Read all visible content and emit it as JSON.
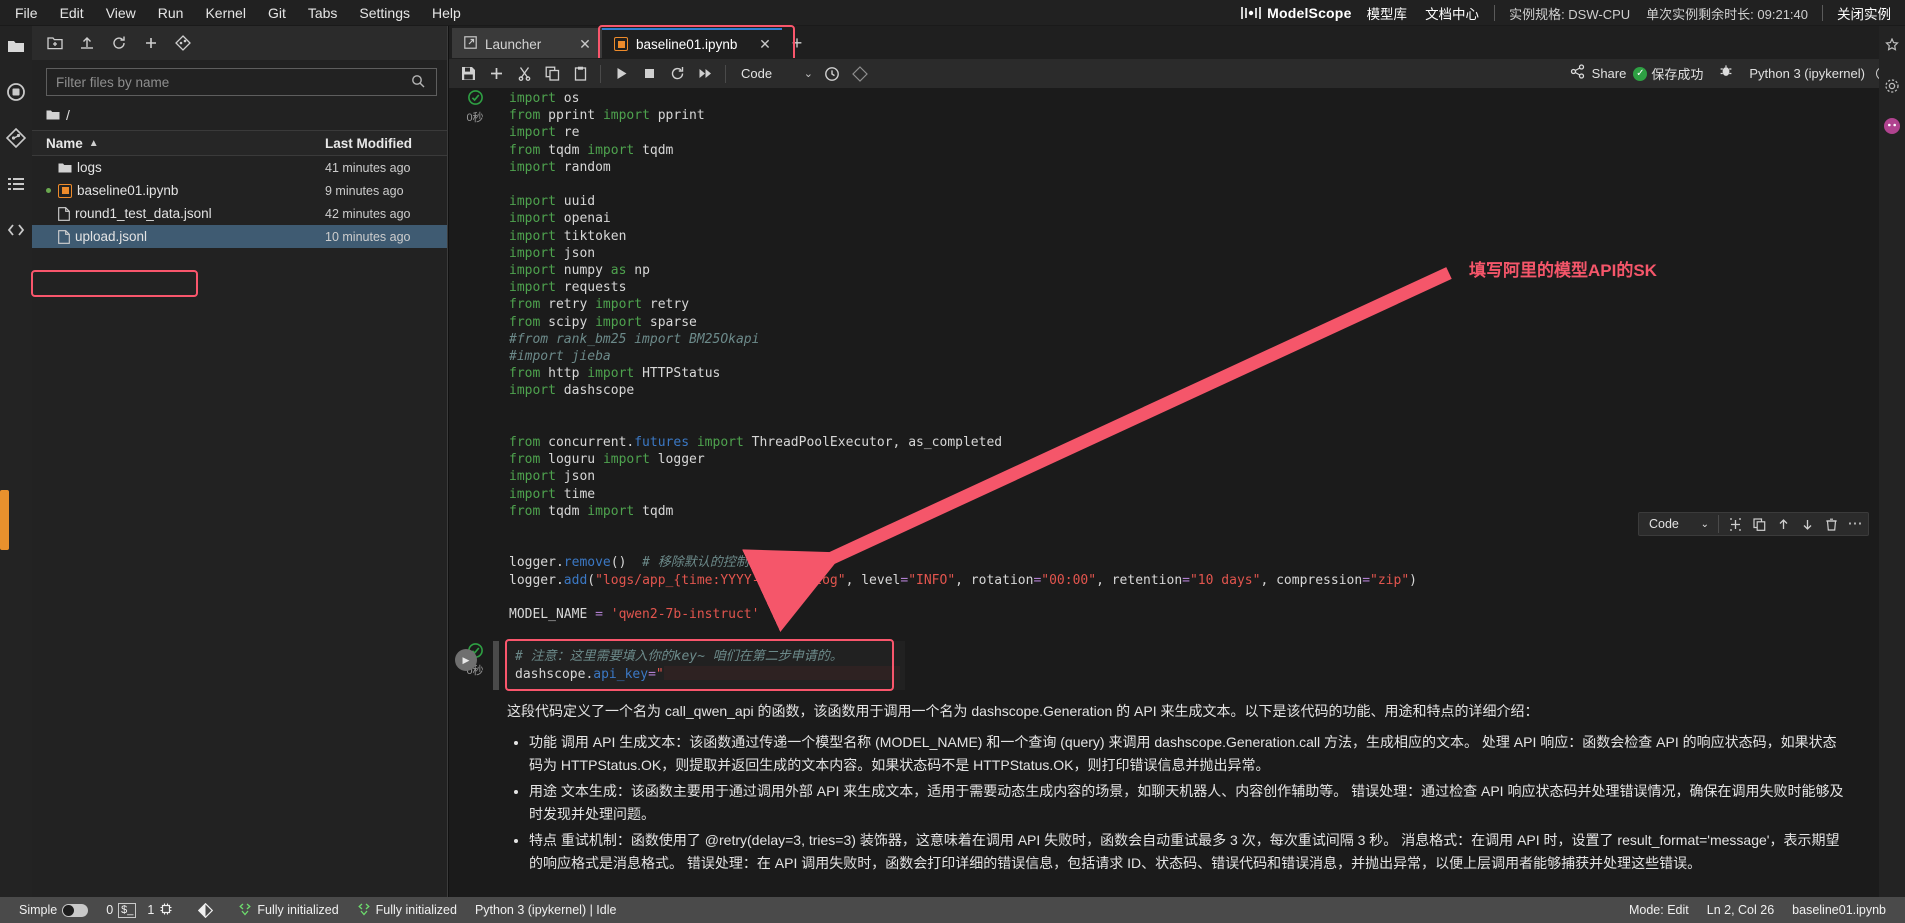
{
  "menubar": {
    "items": [
      "File",
      "Edit",
      "View",
      "Run",
      "Kernel",
      "Git",
      "Tabs",
      "Settings",
      "Help"
    ]
  },
  "topbar": {
    "brand": "ModelScope",
    "links": [
      "模型库",
      "文档中心"
    ],
    "instance_spec": "实例规格: DSW-CPU",
    "remaining": "单次实例剩余时长: 09:21:40",
    "close_instance": "关闭实例"
  },
  "filebrowser": {
    "toolbar_icons": [
      "new-folder-icon",
      "upload-icon",
      "refresh-icon",
      "new-launcher-icon",
      "git-clone-icon"
    ],
    "filter_placeholder": "Filter files by name",
    "filter_value": "",
    "breadcrumb": "/",
    "columns": {
      "name": "Name",
      "modified": "Last Modified"
    },
    "rows": [
      {
        "name": "logs",
        "modified": "41 minutes ago",
        "icon": "folder-icon",
        "dirty": false,
        "selected": false,
        "highlighted": false
      },
      {
        "name": "baseline01.ipynb",
        "modified": "9 minutes ago",
        "icon": "notebook-icon",
        "dirty": true,
        "selected": false,
        "highlighted": true
      },
      {
        "name": "round1_test_data.jsonl",
        "modified": "42 minutes ago",
        "icon": "file-icon",
        "dirty": false,
        "selected": false,
        "highlighted": false
      },
      {
        "name": "upload.jsonl",
        "modified": "10 minutes ago",
        "icon": "file-icon",
        "dirty": false,
        "selected": true,
        "highlighted": false
      }
    ]
  },
  "tabs": [
    {
      "label": "Launcher",
      "icon": "launcher-icon",
      "active": false,
      "highlighted": false
    },
    {
      "label": "baseline01.ipynb",
      "icon": "notebook-icon",
      "active": true,
      "highlighted": true
    }
  ],
  "tab_add_label": "+",
  "notebook_toolbar": {
    "icons": [
      "save-icon",
      "add-cell-icon",
      "cut-icon",
      "copy-icon",
      "paste-icon",
      "run-icon",
      "stop-icon",
      "restart-icon",
      "restart-run-all-icon"
    ],
    "cell_type": "Code",
    "chevron": "⌄",
    "history_icon": "history-icon",
    "git_icon": "git-icon",
    "share_label": "Share",
    "save_status": "保存成功",
    "debug_icon": "debugger-icon",
    "kernel_name": "Python 3 (ipykernel)",
    "kernel_status_icon": "kernel-idle-circle"
  },
  "cells": [
    {
      "type": "code",
      "prompt": "",
      "lines": [
        {
          "seg": [
            {
              "t": "import",
              "c": "kw"
            },
            {
              "t": " os",
              "c": "var"
            }
          ]
        },
        {
          "seg": [
            {
              "t": "from",
              "c": "kw"
            },
            {
              "t": " pprint ",
              "c": "var"
            },
            {
              "t": "import",
              "c": "kw"
            },
            {
              "t": " pprint",
              "c": "var"
            }
          ]
        },
        {
          "seg": [
            {
              "t": "import",
              "c": "kw"
            },
            {
              "t": " re",
              "c": "var"
            }
          ]
        },
        {
          "seg": [
            {
              "t": "from",
              "c": "kw"
            },
            {
              "t": " tqdm ",
              "c": "var"
            },
            {
              "t": "import",
              "c": "kw"
            },
            {
              "t": " tqdm",
              "c": "var"
            }
          ]
        },
        {
          "seg": [
            {
              "t": "import",
              "c": "kw"
            },
            {
              "t": " random",
              "c": "var"
            }
          ]
        },
        {
          "seg": []
        },
        {
          "seg": [
            {
              "t": "import",
              "c": "kw"
            },
            {
              "t": " uuid",
              "c": "var"
            }
          ]
        },
        {
          "seg": [
            {
              "t": "import",
              "c": "kw"
            },
            {
              "t": " openai",
              "c": "var"
            }
          ]
        },
        {
          "seg": [
            {
              "t": "import",
              "c": "kw"
            },
            {
              "t": " tiktoken",
              "c": "var"
            }
          ]
        },
        {
          "seg": [
            {
              "t": "import",
              "c": "kw"
            },
            {
              "t": " json",
              "c": "var"
            }
          ]
        },
        {
          "seg": [
            {
              "t": "import",
              "c": "kw"
            },
            {
              "t": " numpy ",
              "c": "var"
            },
            {
              "t": "as",
              "c": "kw"
            },
            {
              "t": " np",
              "c": "var"
            }
          ]
        },
        {
          "seg": [
            {
              "t": "import",
              "c": "kw"
            },
            {
              "t": " requests",
              "c": "var"
            }
          ]
        },
        {
          "seg": [
            {
              "t": "from",
              "c": "kw"
            },
            {
              "t": " retry ",
              "c": "var"
            },
            {
              "t": "import",
              "c": "kw"
            },
            {
              "t": " retry",
              "c": "var"
            }
          ]
        },
        {
          "seg": [
            {
              "t": "from",
              "c": "kw"
            },
            {
              "t": " scipy ",
              "c": "var"
            },
            {
              "t": "import",
              "c": "kw"
            },
            {
              "t": " sparse",
              "c": "var"
            }
          ]
        },
        {
          "seg": [
            {
              "t": "#from rank_bm25 import BM25Okapi",
              "c": "cm"
            }
          ]
        },
        {
          "seg": [
            {
              "t": "#import jieba",
              "c": "cm"
            }
          ]
        },
        {
          "seg": [
            {
              "t": "from",
              "c": "kw"
            },
            {
              "t": " http ",
              "c": "var"
            },
            {
              "t": "import",
              "c": "kw"
            },
            {
              "t": " HTTPStatus",
              "c": "var"
            }
          ]
        },
        {
          "seg": [
            {
              "t": "import",
              "c": "kw"
            },
            {
              "t": " dashscope",
              "c": "var"
            }
          ]
        },
        {
          "seg": []
        },
        {
          "seg": []
        },
        {
          "seg": [
            {
              "t": "from",
              "c": "kw"
            },
            {
              "t": " concurrent.",
              "c": "var"
            },
            {
              "t": "futures",
              "c": "blu"
            },
            {
              "t": " ",
              "c": "var"
            },
            {
              "t": "import",
              "c": "kw"
            },
            {
              "t": " ThreadPoolExecutor, as_completed",
              "c": "var"
            }
          ]
        },
        {
          "seg": [
            {
              "t": "from",
              "c": "kw"
            },
            {
              "t": " loguru ",
              "c": "var"
            },
            {
              "t": "import",
              "c": "kw"
            },
            {
              "t": " logger",
              "c": "var"
            }
          ]
        },
        {
          "seg": [
            {
              "t": "import",
              "c": "kw"
            },
            {
              "t": " json",
              "c": "var"
            }
          ]
        },
        {
          "seg": [
            {
              "t": "import",
              "c": "kw"
            },
            {
              "t": " time",
              "c": "var"
            }
          ]
        },
        {
          "seg": [
            {
              "t": "from",
              "c": "kw"
            },
            {
              "t": " tqdm ",
              "c": "var"
            },
            {
              "t": "import",
              "c": "kw"
            },
            {
              "t": " tqdm",
              "c": "var"
            }
          ]
        },
        {
          "seg": []
        },
        {
          "seg": []
        },
        {
          "seg": [
            {
              "t": "logger.",
              "c": "var"
            },
            {
              "t": "remove",
              "c": "fn"
            },
            {
              "t": "()  ",
              "c": "var"
            },
            {
              "t": "# 移除默认的控制台输出",
              "c": "cm"
            }
          ]
        },
        {
          "seg": [
            {
              "t": "logger.",
              "c": "var"
            },
            {
              "t": "add",
              "c": "fn"
            },
            {
              "t": "(",
              "c": "var"
            },
            {
              "t": "\"logs/app_{time:YYYY-MM-DD}.log\"",
              "c": "str"
            },
            {
              "t": ", level",
              "c": "var"
            },
            {
              "t": "=",
              "c": "op"
            },
            {
              "t": "\"INFO\"",
              "c": "str"
            },
            {
              "t": ", rotation",
              "c": "var"
            },
            {
              "t": "=",
              "c": "op"
            },
            {
              "t": "\"00:00\"",
              "c": "str"
            },
            {
              "t": ", retention",
              "c": "var"
            },
            {
              "t": "=",
              "c": "op"
            },
            {
              "t": "\"10 days\"",
              "c": "str"
            },
            {
              "t": ", compression",
              "c": "var"
            },
            {
              "t": "=",
              "c": "op"
            },
            {
              "t": "\"zip\"",
              "c": "str"
            },
            {
              "t": ")",
              "c": "var"
            }
          ]
        },
        {
          "seg": []
        },
        {
          "seg": [
            {
              "t": "MODEL_NAME ",
              "c": "var"
            },
            {
              "t": "=",
              "c": "op"
            },
            {
              "t": " 'qwen2-7b-instruct'",
              "c": "str"
            }
          ]
        }
      ]
    },
    {
      "type": "code-active",
      "prompt_ok": "✔",
      "prompt_sec": "0秒",
      "highlighted": true,
      "lines": [
        {
          "seg": [
            {
              "t": "# 注意：这里需要填入你的key~ 咱们在第二步申请的。",
              "c": "cm"
            }
          ]
        },
        {
          "seg": [
            {
              "t": "dashscope.",
              "c": "var"
            },
            {
              "t": "api_key",
              "c": "fn"
            },
            {
              "t": "=",
              "c": "op"
            },
            {
              "t": "\"",
              "c": "str"
            },
            {
              "t": "__REDACTED__",
              "c": "redact"
            }
          ]
        }
      ]
    }
  ],
  "markdown": {
    "intro": "这段代码定义了一个名为 call_qwen_api 的函数，该函数用于调用一个名为 dashscope.Generation 的 API 来生成文本。以下是该代码的功能、用途和特点的详细介绍：",
    "bullets": [
      "功能 调用 API 生成文本：该函数通过传递一个模型名称 (MODEL_NAME) 和一个查询 (query) 来调用 dashscope.Generation.call 方法，生成相应的文本。 处理 API 响应：函数会检查 API 的响应状态码，如果状态码为 HTTPStatus.OK，则提取并返回生成的文本内容。如果状态码不是 HTTPStatus.OK，则打印错误信息并抛出异常。",
      "用途 文本生成：该函数主要用于通过调用外部 API 来生成文本，适用于需要动态生成内容的场景，如聊天机器人、内容创作辅助等。 错误处理：通过检查 API 响应状态码并处理错误情况，确保在调用失败时能够及时发现并处理问题。",
      "特点 重试机制：函数使用了 @retry(delay=3, tries=3) 装饰器，这意味着在调用 API 失败时，函数会自动重试最多 3 次，每次重试间隔 3 秒。 消息格式：在调用 API 时，设置了 result_format='message'，表示期望的响应格式是消息格式。 错误处理：在 API 调用失败时，函数会打印详细的错误信息，包括请求 ID、状态码、错误代码和错误消息，并抛出异常，以便上层调用者能够捕获并处理这些错误。"
    ]
  },
  "annotation": {
    "text": "填写阿里的模型API的SK",
    "color": "#f5566a"
  },
  "statusbar": {
    "mode_label": "Simple",
    "terminals": "0",
    "kernels": "1",
    "git_icon": "git-branch-icon",
    "ext1": "Fully initialized",
    "ext2": "Fully initialized",
    "kernel_state": "Python 3 (ipykernel) | Idle",
    "mode": "Mode: Edit",
    "cursor": "Ln 2, Col 26",
    "filename": "baseline01.ipynb"
  }
}
